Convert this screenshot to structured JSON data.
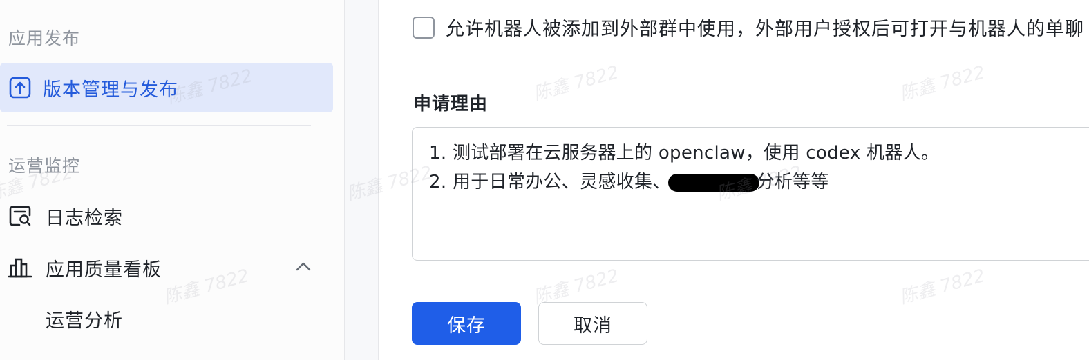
{
  "sidebar": {
    "section_publish": "应用发布",
    "active_item": "版本管理与发布",
    "section_ops": "运营监控",
    "item_log_search": "日志检索",
    "item_quality_board": "应用质量看板",
    "sub_item_ops_analysis": "运营分析"
  },
  "form": {
    "checkbox_label": "允许机器人被添加到外部群中使用，外部用户授权后可打开与机器人的单聊",
    "checkbox_checked": false,
    "reason_label": "申请理由",
    "reason_line1": "1. 测试部署在云服务器上的 openclaw，使用 codex 机器人。",
    "reason_line2_prefix": "2. 用于日常办公、灵感收集、",
    "reason_line2_suffix": "分析等等"
  },
  "buttons": {
    "save": "保存",
    "cancel": "取消"
  },
  "watermark": "陈鑫 7822",
  "colors": {
    "accent": "#1f5ee8",
    "active_bg": "#e1e8fb",
    "active_text": "#245bdb"
  }
}
